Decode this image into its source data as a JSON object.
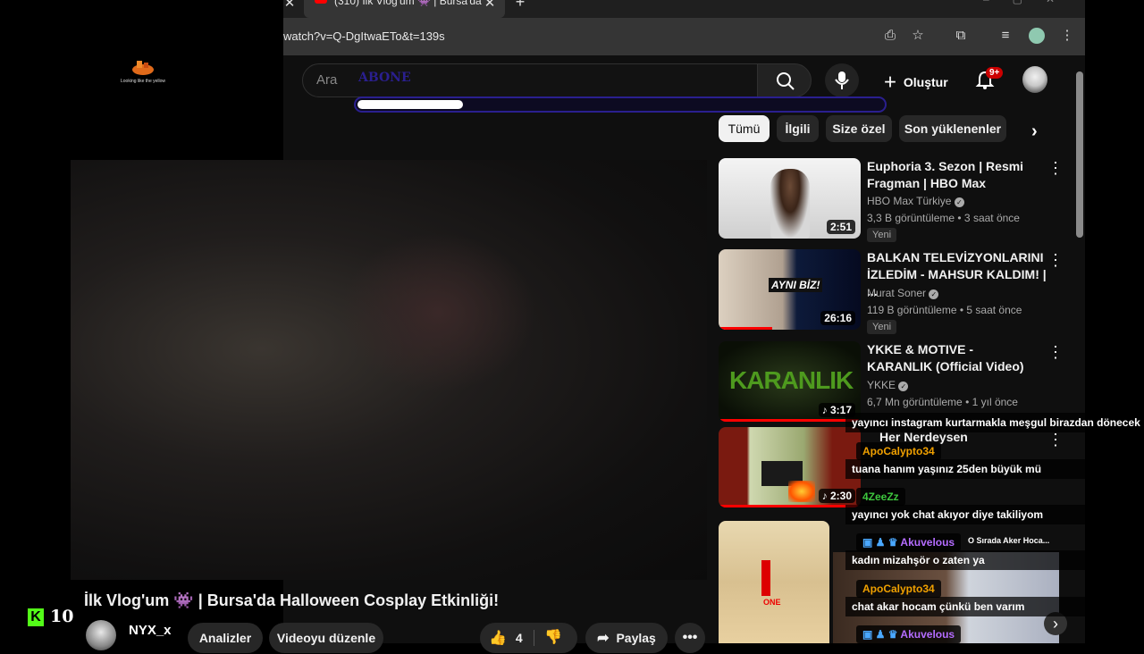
{
  "browser": {
    "tab_title": "(310) İlk Vlog'um 👾 | Bursa'da",
    "url": "watch?v=Q-DgItwaETo&t=139s"
  },
  "stream_overlay": {
    "logo_caption": "Looking like the yellow",
    "kick_count": "10",
    "abone_label": "ABONE",
    "progress_fraction": 0.2
  },
  "youtube": {
    "search_placeholder": "Ara",
    "create_label": "Oluştur",
    "notification_count": "9+",
    "filters": [
      "Tümü",
      "İlgili",
      "Size özel",
      "Son yüklenenler"
    ],
    "video_title": "İlk Vlog'um 👾 | Bursa'da Halloween Cosplay Etkinliği!",
    "channel_name": "NYX_x",
    "analytics_label": "Analizler",
    "edit_label": "Videoyu düzenle",
    "like_count": "4",
    "share_label": "Paylaş",
    "recommendations": [
      {
        "title": "Euphoria 3. Sezon | Resmi Fragman | HBO Max",
        "channel": "HBO Max Türkiye",
        "meta": "3,3 B görüntüleme • 3 saat önce",
        "duration": "2:51",
        "badge": "Yeni"
      },
      {
        "title": "BALKAN TELEVİZYONLARINI İZLEDİM - MAHSUR KALDIM! | ...",
        "channel": "Murat Soner",
        "meta": "119 B görüntüleme • 5 saat önce",
        "duration": "26:16",
        "badge": "Yeni",
        "thumb_text": "AYNI BİZ!"
      },
      {
        "title": "YKKE & MOTIVE - KARANLIK (Official Video)",
        "channel": "YKKE",
        "meta": "6,7 Mn görüntüleme • 1 yıl önce",
        "duration": "3:17",
        "thumb_text": "KARANLIK"
      },
      {
        "title": "Her Nerdeysen",
        "duration": "2:30"
      }
    ]
  },
  "chat": {
    "messages": [
      {
        "user": "",
        "text": "yayıncı instagram kurtarmakla meşgul birazdan dönecek",
        "color": "#ffffff"
      },
      {
        "user": "ApoCalypto34",
        "text": "tuana hanım yaşınız 25den büyük mü",
        "color": "#f0a000"
      },
      {
        "user": "4ZeeZz",
        "text": "yayıncı yok chat akıyor diye takiliyom",
        "color": "#3ec63e"
      },
      {
        "user": "Akuvelous",
        "text": "kadın mizahşör o zaten ya",
        "color": "#b46cff"
      },
      {
        "user": "ApoCalypto34",
        "text": "chat akar hocam çünkü ben varım",
        "color": "#f0a000"
      },
      {
        "user": "Akuvelous",
        "text": "",
        "color": "#b46cff"
      }
    ],
    "webcam_caption": "O Sırada Aker Hoca..."
  }
}
